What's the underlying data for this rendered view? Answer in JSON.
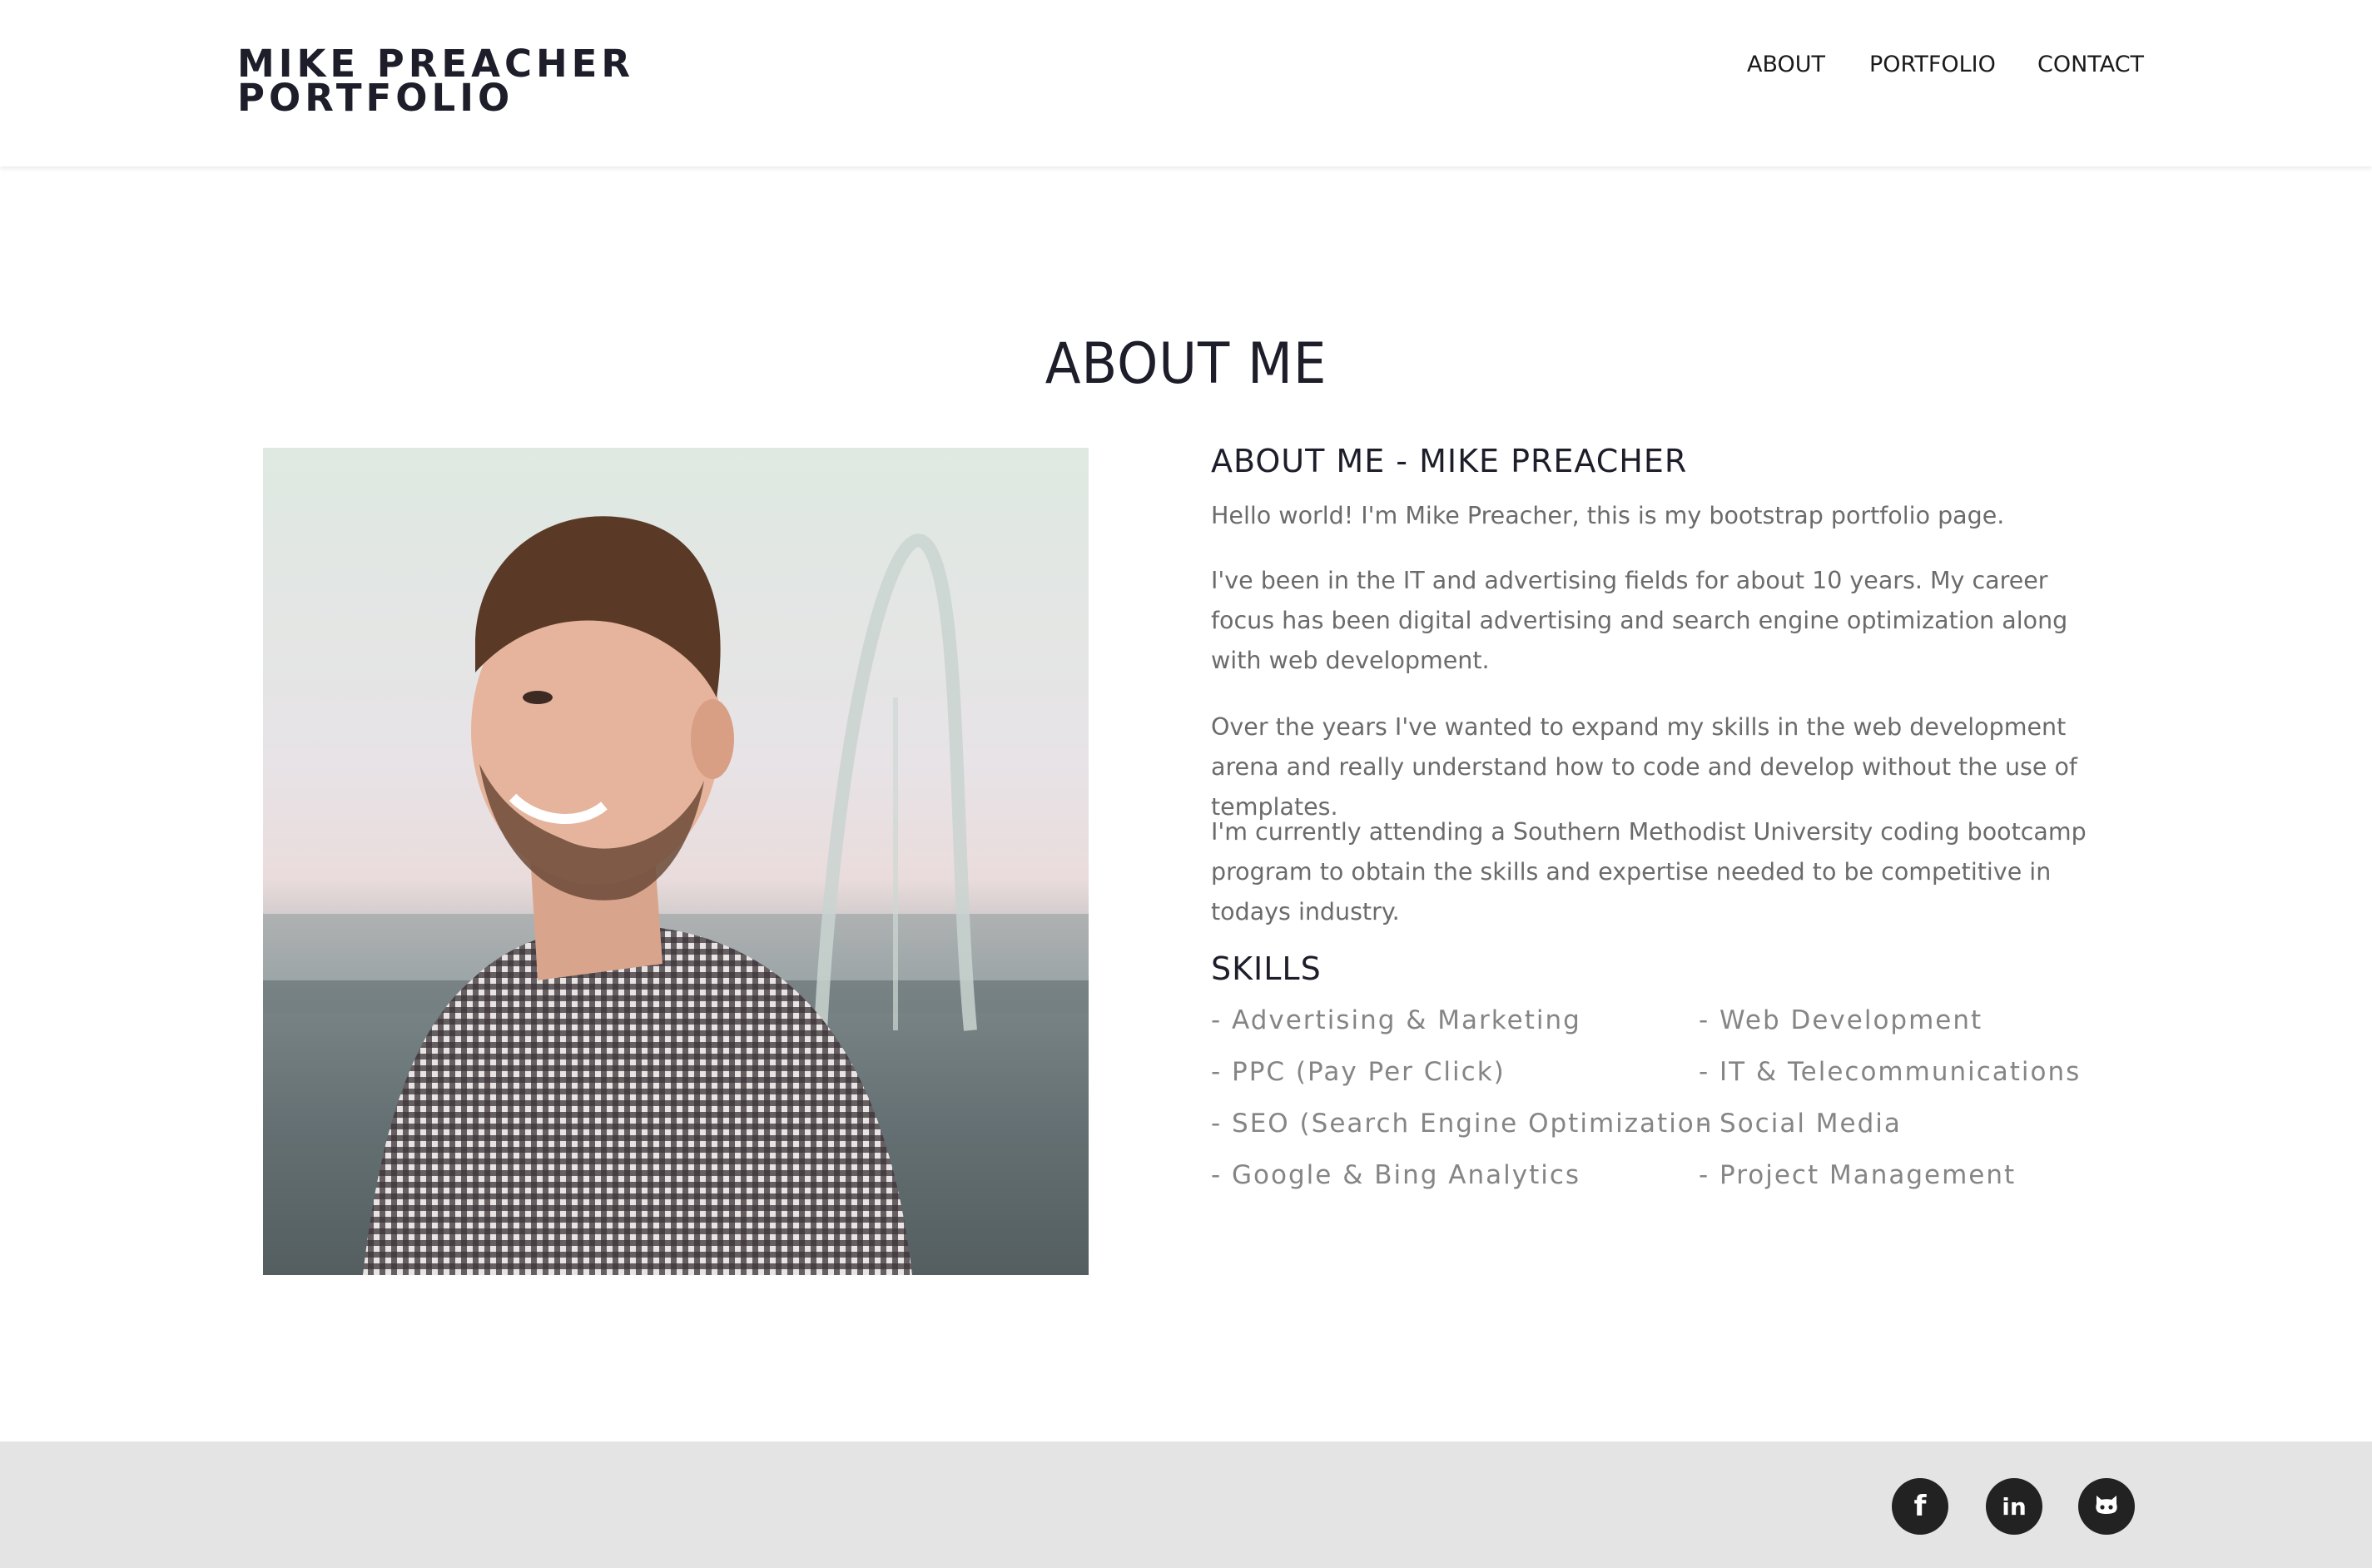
{
  "header": {
    "brand_line1": "MIKE PREACHER",
    "brand_line2": "PORTFOLIO",
    "nav": [
      {
        "label": "ABOUT"
      },
      {
        "label": "PORTFOLIO"
      },
      {
        "label": "CONTACT"
      }
    ]
  },
  "about": {
    "section_title": "ABOUT ME",
    "heading": "ABOUT ME - MIKE PREACHER",
    "paragraphs": [
      "Hello world! I'm Mike Preacher, this is my bootstrap portfolio page.",
      "I've been in the IT and advertising fields for about 10 years. My career focus has been digital advertising and search engine optimization along with web development.",
      "Over the years I've wanted to expand my skills in the web development arena and really understand how to code and develop without the use of templates.",
      "I'm currently attending a Southern Methodist University coding bootcamp program to obtain the skills and expertise needed to be competitive in todays industry."
    ],
    "skills_heading": "SKILLS",
    "skills_left": [
      "- Advertising & Marketing",
      "- PPC (Pay Per Click)",
      "- SEO (Search Engine Optimization",
      "- Google & Bing Analytics"
    ],
    "skills_right": [
      "- Web Development",
      "- IT & Telecommunications",
      "- Social Media",
      "- Project Management"
    ]
  },
  "footer": {
    "social": [
      {
        "icon": "facebook-icon",
        "glyph": "f"
      },
      {
        "icon": "linkedin-icon",
        "glyph": "in"
      },
      {
        "icon": "github-icon"
      }
    ]
  },
  "colors": {
    "header_bg": "#ffffff",
    "heading_text": "#1e1e2a",
    "body_text": "#6b6b6b",
    "skill_text": "#858585",
    "footer_bg": "#e4e4e4",
    "social_circle": "#222222"
  }
}
